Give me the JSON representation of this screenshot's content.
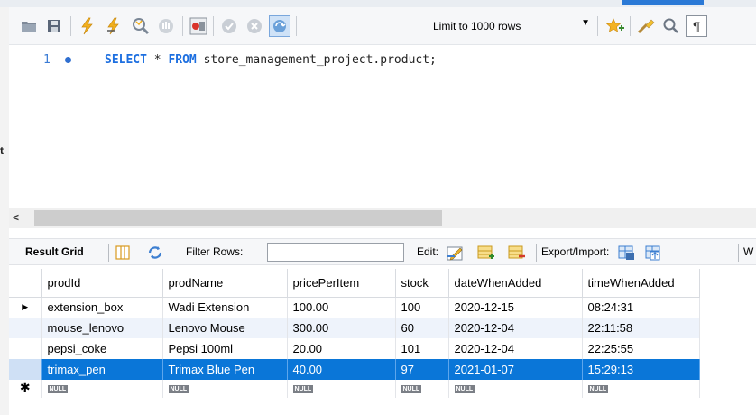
{
  "toolbar": {
    "limit_label": "Limit to 1000 rows",
    "icons": [
      "folder-icon",
      "save-icon",
      "execute-icon",
      "execute-current-icon",
      "explain-icon",
      "stop-icon",
      "toggle-error-icon",
      "commit-icon",
      "rollback-icon",
      "autocommit-icon",
      "bookmark-icon",
      "beautify-icon",
      "find-icon",
      "invisible-chars-icon"
    ]
  },
  "editor": {
    "line_number": "1",
    "code": {
      "select": "SELECT",
      "star": " * ",
      "from": "FROM",
      "table": " store_management_project.product;"
    }
  },
  "left_edge_char": "t",
  "results": {
    "result_grid_label": "Result Grid",
    "filter_label": "Filter Rows:",
    "filter_value": "",
    "edit_label": "Edit:",
    "export_label": "Export/Import:",
    "wrap_label": "W"
  },
  "grid": {
    "columns": [
      "prodId",
      "prodName",
      "pricePerItem",
      "stock",
      "dateWhenAdded",
      "timeWhenAdded"
    ],
    "rows": [
      [
        "extension_box",
        "Wadi Extension",
        "100.00",
        "100",
        "2020-12-15",
        "08:24:31"
      ],
      [
        "mouse_lenovo",
        "Lenovo Mouse",
        "300.00",
        "60",
        "2020-12-04",
        "22:11:58"
      ],
      [
        "pepsi_coke",
        "Pepsi 100ml",
        "20.00",
        "101",
        "2020-12-04",
        "22:25:55"
      ],
      [
        "trimax_pen",
        "Trimax Blue Pen",
        "40.00",
        "97",
        "2021-01-07",
        "15:29:13"
      ]
    ],
    "null_label": "NULL",
    "current_row_marker": "▶",
    "new_row_marker": "✱"
  },
  "colors": {
    "selection": "#0a76d8",
    "keyword": "#1d6fe0"
  }
}
